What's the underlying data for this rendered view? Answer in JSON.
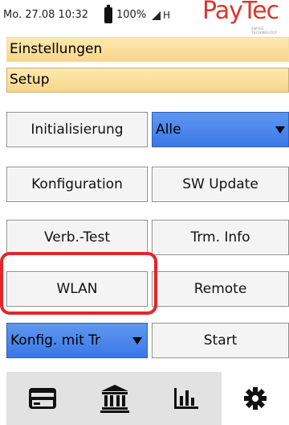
{
  "status_bar": {
    "datetime": "Mo. 27.08 10:32",
    "battery": "100%",
    "network": "H",
    "logo": "PayTec",
    "logo_sub": "SWISS TECHNOLOGY"
  },
  "header": {
    "title": "Einstellungen",
    "section": "Setup"
  },
  "buttons": {
    "initialisierung": "Initialisierung",
    "alle_select": "Alle",
    "konfiguration": "Konfiguration",
    "sw_update": "SW Update",
    "verb_test": "Verb.-Test",
    "trm_info": "Trm. Info",
    "wlan": "WLAN",
    "remote": "Remote",
    "konfig_select": "Konfig. mit Tr",
    "start": "Start"
  },
  "colors": {
    "header_bg": "#fde9b0",
    "select_bg": "#3a78e6",
    "highlight": "#e3262b",
    "logo": "#d9372e"
  },
  "bottom_nav": [
    {
      "icon": "credit-card-icon"
    },
    {
      "icon": "bank-icon"
    },
    {
      "icon": "bar-chart-icon"
    },
    {
      "icon": "gear-icon",
      "selected": true
    }
  ]
}
